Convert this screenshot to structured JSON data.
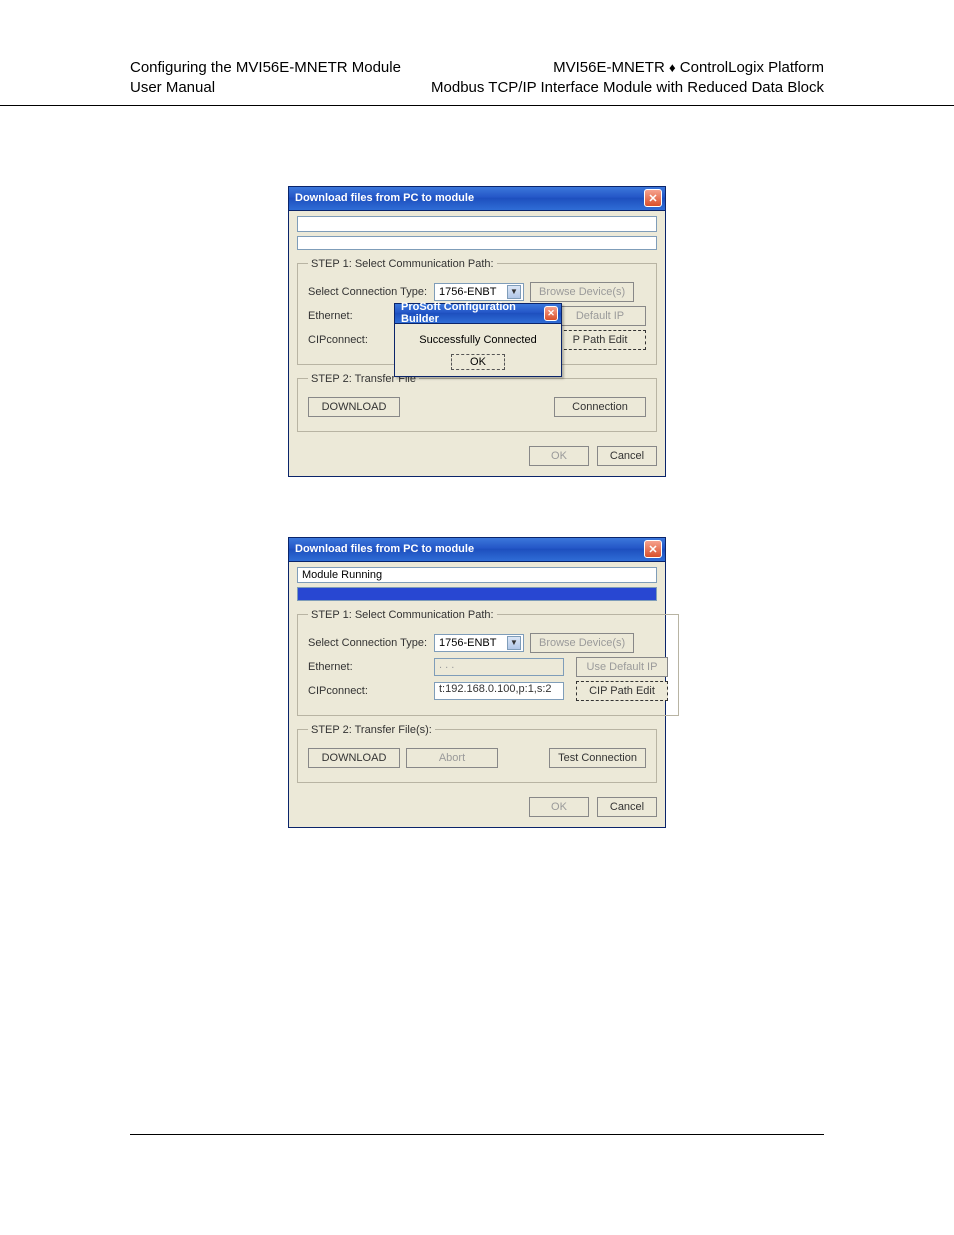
{
  "header": {
    "left_line1": "Configuring the MVI56E-MNETR Module",
    "left_line2": "User Manual",
    "right_line1_a": "MVI56E-MNETR",
    "right_line1_sep": "♦",
    "right_line1_b": "ControlLogix Platform",
    "right_line2": "Modbus TCP/IP Interface Module with Reduced Data Block"
  },
  "dialog1": {
    "title": "Download files from PC to module",
    "status_text": "",
    "step1_legend": "STEP 1: Select Communication Path:",
    "conn_type_label": "Select Connection Type:",
    "conn_type_value": "1756-ENBT",
    "browse_btn": "Browse Device(s)",
    "ethernet_label": "Ethernet:",
    "default_ip_btn": "Default IP",
    "cip_label": "CIPconnect:",
    "path_edit_btn": "P Path Edit",
    "step2_legend": "STEP 2: Transfer File",
    "download_btn": "DOWNLOAD",
    "connection_btn": "Connection",
    "ok_btn": "OK",
    "cancel_btn": "Cancel",
    "popup": {
      "title": "ProSoft Configuration Builder",
      "msg": "Successfully Connected",
      "ok": "OK"
    }
  },
  "dialog2": {
    "title": "Download files from PC to module",
    "status_text": "Module Running",
    "step1_legend": "STEP 1: Select Communication Path:",
    "conn_type_label": "Select Connection Type:",
    "conn_type_value": "1756-ENBT",
    "browse_btn": "Browse Device(s)",
    "ethernet_label": "Ethernet:",
    "ethernet_value": "   .   .   .   ",
    "default_ip_btn": "Use Default IP",
    "cip_label": "CIPconnect:",
    "cip_value": "t:192.168.0.100,p:1,s:2",
    "cip_edit_btn": "CIP Path Edit",
    "step2_legend": "STEP 2: Transfer File(s):",
    "download_btn": "DOWNLOAD",
    "abort_btn": "Abort",
    "test_btn": "Test Connection",
    "ok_btn": "OK",
    "cancel_btn": "Cancel"
  }
}
